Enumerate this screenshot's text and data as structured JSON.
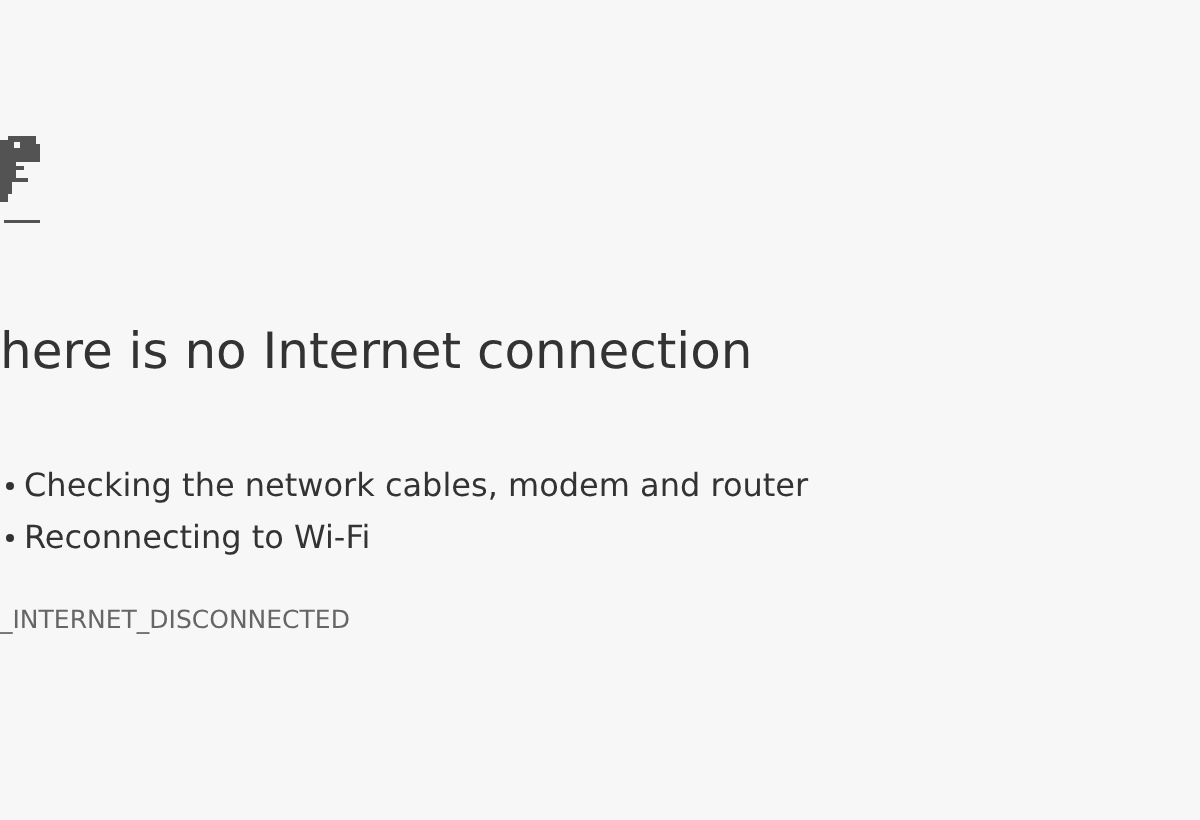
{
  "heading": "here is no Internet connection",
  "suggestions": [
    "Checking the network cables, modem and router",
    "Reconnecting to Wi-Fi"
  ],
  "error_code": "_INTERNET_DISCONNECTED"
}
